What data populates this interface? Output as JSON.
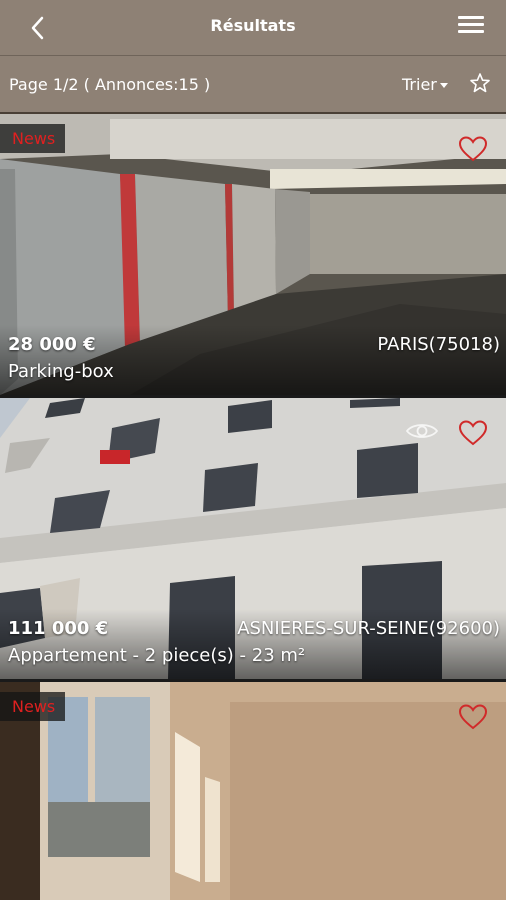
{
  "header": {
    "title": "Résultats",
    "back_icon": "chevron-left-icon",
    "menu_icon": "hamburger-menu-icon"
  },
  "subheader": {
    "page_info": "Page 1/2 ( Annonces:15 )",
    "sort_label": "Trier",
    "favorite_icon": "star-outline-icon"
  },
  "listings": [
    {
      "badge": "News",
      "price": "28 000 €",
      "location": "PARIS(75018)",
      "type": "Parking-box"
    },
    {
      "badge": "",
      "price": "111 000 €",
      "location": "ASNIERES-SUR-SEINE(92600)",
      "type": "Appartement - 2 piece(s) - 23 m²"
    },
    {
      "badge": "News",
      "price": "",
      "location": "",
      "type": ""
    }
  ],
  "colors": {
    "header_bg": "#8e8175",
    "badge_text": "#e02020",
    "heart": "#d02a2a"
  }
}
